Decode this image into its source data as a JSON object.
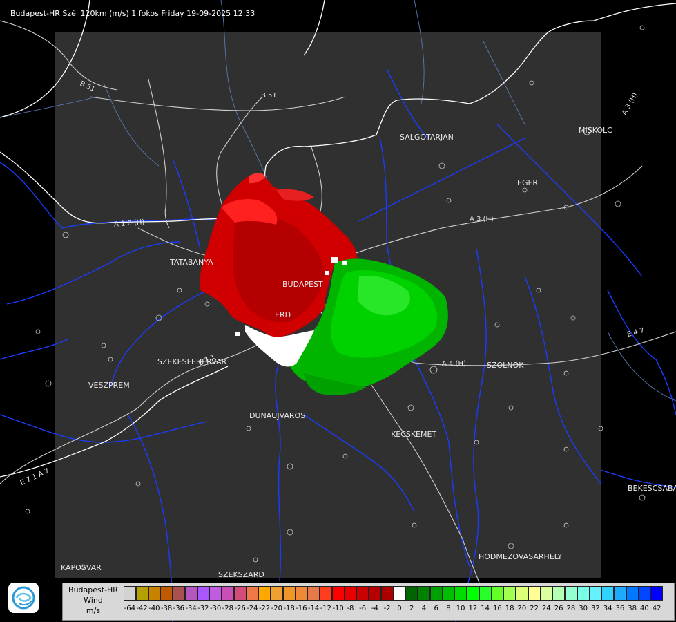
{
  "title": "Budapest-HR Szél 120km (m/s) 1 fokos Friday 19-09-2025 12:33",
  "cities": [
    {
      "name": "SALGOTARJAN",
      "key": "salgotarjan"
    },
    {
      "name": "MISKOLC",
      "key": "miskolc"
    },
    {
      "name": "EGER",
      "key": "eger"
    },
    {
      "name": "TATABANYA",
      "key": "tatabanya"
    },
    {
      "name": "BUDAPEST",
      "key": "budapest"
    },
    {
      "name": "ERD",
      "key": "erd"
    },
    {
      "name": "SZEKESFEHERVAR",
      "key": "szekesfehervar"
    },
    {
      "name": "VESZPREM",
      "key": "veszprem"
    },
    {
      "name": "DUNAUJVAROS",
      "key": "dunaujvaros"
    },
    {
      "name": "KECSKEMET",
      "key": "kecskemet"
    },
    {
      "name": "SZOLNOK",
      "key": "szolnok"
    },
    {
      "name": "HODMEZOVASARHELY",
      "key": "hodmezovasarhely"
    },
    {
      "name": "BEKESCSABA",
      "key": "bekescsaba"
    },
    {
      "name": "KAPOSVAR",
      "key": "kaposvar"
    },
    {
      "name": "SZEKSZARD",
      "key": "szekszard"
    }
  ],
  "roads": [
    {
      "name": "B 51",
      "key": "b51-west"
    },
    {
      "name": "B 51",
      "key": "b51-east"
    },
    {
      "name": "A 3 (H)",
      "key": "a3-north"
    },
    {
      "name": "A 3 (H)",
      "key": "a3-center"
    },
    {
      "name": "A 1 0 (H)",
      "key": "a10"
    },
    {
      "name": "A 4 (H)",
      "key": "a4"
    },
    {
      "name": "E 4 7",
      "key": "e47"
    },
    {
      "name": "E 7 1",
      "key": "e71-sz"
    },
    {
      "name": "E 7 1 A 7",
      "key": "e71-sw"
    }
  ],
  "legend": {
    "title_lines": [
      "Budapest-HR",
      "Wind",
      "m/s"
    ],
    "values": [
      "-64",
      "-42",
      "-40",
      "-38",
      "-36",
      "-34",
      "-32",
      "-30",
      "-28",
      "-26",
      "-24",
      "-22",
      "-20",
      "-18",
      "-16",
      "-14",
      "-12",
      "-10",
      "-8",
      "-6",
      "-4",
      "-2",
      "0",
      "2",
      "4",
      "6",
      "8",
      "10",
      "12",
      "14",
      "16",
      "18",
      "20",
      "22",
      "24",
      "26",
      "28",
      "30",
      "32",
      "34",
      "36",
      "38",
      "40",
      "42"
    ],
    "colors": [
      "#d2d2d2",
      "#b4a000",
      "#c88200",
      "#be5a00",
      "#aa5050",
      "#b456be",
      "#aa55ff",
      "#c05ce0",
      "#c850b4",
      "#d24c7a",
      "#ee7848",
      "#ffa800",
      "#f0a030",
      "#f09628",
      "#ee8a36",
      "#e6784a",
      "#ff3c1e",
      "#ff0000",
      "#e60000",
      "#c80000",
      "#b40000",
      "#aa0000",
      "#ffffff",
      "#006400",
      "#008200",
      "#00a000",
      "#00be00",
      "#00dc00",
      "#00ff00",
      "#28ff28",
      "#64ff28",
      "#a0ff50",
      "#dcff78",
      "#ffff96",
      "#dcffa0",
      "#b4ffb4",
      "#96ffd2",
      "#78ffe6",
      "#64f0ff",
      "#32d2ff",
      "#1eaaff",
      "#0078ff",
      "#0046ff",
      "#0000ff"
    ]
  },
  "colors": {
    "background": "#000000",
    "radar_area": "#303030",
    "rivers": "#1a3cff",
    "borders": "#ffffff",
    "receding": "#ff0000",
    "approaching": "#00c800"
  }
}
